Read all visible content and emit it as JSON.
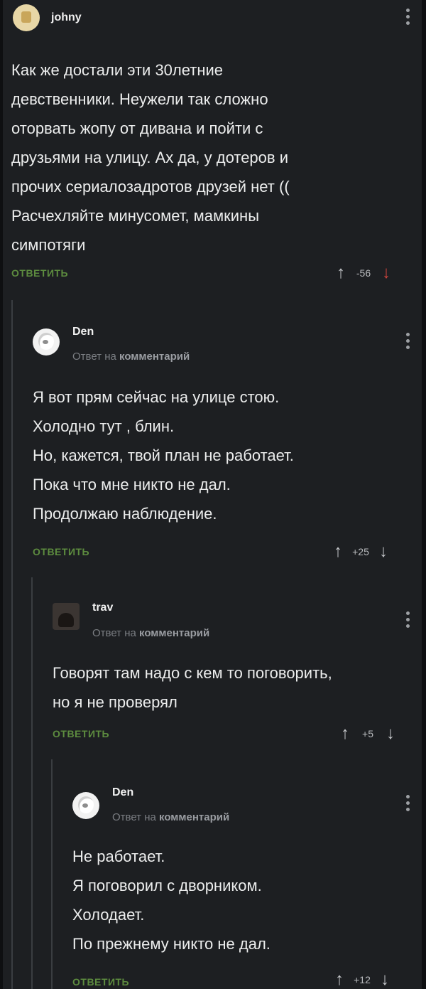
{
  "comments": [
    {
      "username": "johny",
      "body": "Как же достали эти 30летние\nдевственники. Неужели так сложно\nоторвать жопу от дивана и пойти с\nдрузьями на улицу. Ах да, у дотеров и\nпрочих сериалозадротов друзей нет ((\nРасчехляйте минусомет, мамкины\nсимпотяги",
      "reply_label": "ОТВЕТИТЬ",
      "score": "-56"
    },
    {
      "username": "Den",
      "reply_prefix": "Ответ на",
      "reply_target": "комментарий",
      "body": "Я вот прям сейчас на улице стою.\nХолодно тут , блин.\nНо, кажется, твой план не работает.\nПока что мне никто не дал.\nПродолжаю наблюдение.",
      "reply_label": "ОТВЕТИТЬ",
      "score": "+25"
    },
    {
      "username": "trav",
      "reply_prefix": "Ответ на",
      "reply_target": "комментарий",
      "body": "Говорят там надо с кем то поговорить,\nно я не проверял",
      "reply_label": "ОТВЕТИТЬ",
      "score": "+5"
    },
    {
      "username": "Den",
      "reply_prefix": "Ответ на",
      "reply_target": "комментарий",
      "body": "Не работает.\nЯ поговорил с дворником.\nХолодает.\nПо прежнему никто не дал.",
      "reply_label": "ОТВЕТИТЬ",
      "score": "+12"
    }
  ],
  "icons": {
    "upvote": "↑",
    "downvote": "↓"
  },
  "colors": {
    "background": "#1d1f22",
    "reply_button": "#5d8c3f",
    "downvote_active": "#d2453f"
  }
}
